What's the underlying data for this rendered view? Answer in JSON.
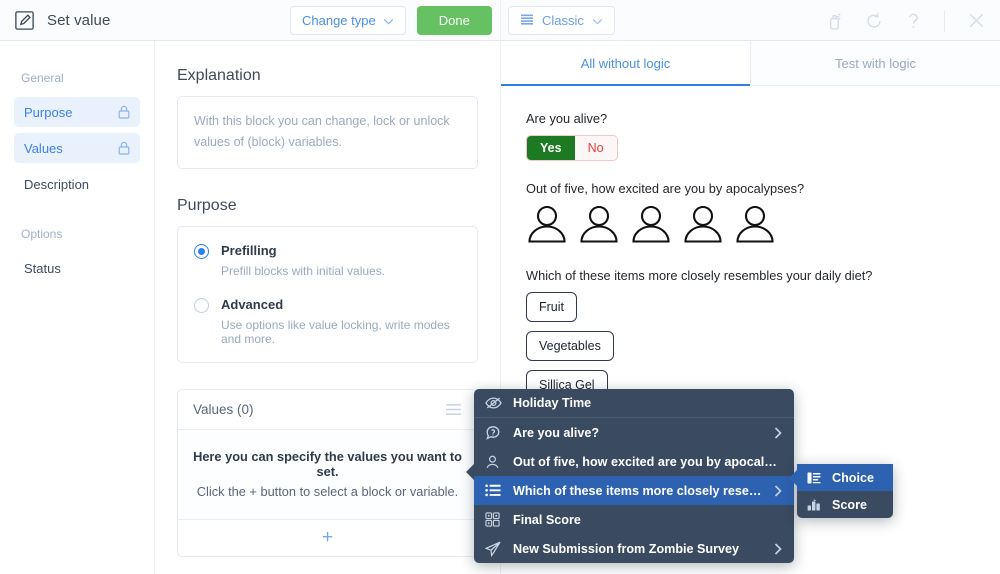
{
  "header": {
    "icon": "pencil-square-icon",
    "title": "Set value",
    "change_type_label": "Change type",
    "done_label": "Done",
    "classic_label": "Classic",
    "icons": [
      "spray-bottle-icon",
      "refresh-icon",
      "help-icon",
      "close-icon"
    ]
  },
  "sidebar": {
    "groups": [
      {
        "label": "General",
        "items": [
          {
            "label": "Purpose",
            "active": true,
            "locked": true
          },
          {
            "label": "Values",
            "active": true,
            "locked": true
          },
          {
            "label": "Description",
            "active": false,
            "locked": false
          }
        ]
      },
      {
        "label": "Options",
        "items": [
          {
            "label": "Status",
            "active": false,
            "locked": false
          }
        ]
      }
    ]
  },
  "middle": {
    "explanation_title": "Explanation",
    "explanation_text": "With this block you can change, lock or unlock values of (block) variables.",
    "purpose_title": "Purpose",
    "purpose_options": [
      {
        "label": "Prefilling",
        "desc": "Prefill blocks with initial values.",
        "selected": true
      },
      {
        "label": "Advanced",
        "desc": "Use options like value locking, write modes and more.",
        "selected": false
      }
    ],
    "values_header": "Values (0)",
    "values_empty_title": "Here you can specify the values you want to set.",
    "values_empty_hint": "Click the + button to select a block or variable.",
    "values_add_label": "+"
  },
  "right": {
    "tabs": [
      {
        "label": "All without logic",
        "active": true
      },
      {
        "label": "Test with logic",
        "active": false
      }
    ],
    "questions": [
      {
        "type": "yesno",
        "label": "Are you alive?",
        "yes_label": "Yes",
        "no_label": "No"
      },
      {
        "type": "rating",
        "label": "Out of five, how excited are you by apocalypses?",
        "count": 5,
        "icon": "person-icon"
      },
      {
        "type": "choice",
        "label": "Which of these items more closely resembles your daily diet?",
        "options": [
          "Fruit",
          "Vegetables",
          "Sillica Gel"
        ]
      }
    ]
  },
  "context_menu": {
    "items": [
      {
        "label": "Holiday Time",
        "icon": "eye-slash-icon",
        "chevron": false,
        "highlighted": false,
        "separator": true
      },
      {
        "label": "Are you alive?",
        "icon": "question-bubble-icon",
        "chevron": true,
        "highlighted": false,
        "separator": false
      },
      {
        "label": "Out of five, how excited are you by apocalypses?",
        "icon": "person-icon",
        "chevron": false,
        "highlighted": false,
        "separator": false
      },
      {
        "label": "Which of these items more closely resembles y…",
        "icon": "list-icon",
        "chevron": true,
        "highlighted": true,
        "separator": false
      },
      {
        "label": "Final Score",
        "icon": "blocks-icon",
        "chevron": false,
        "highlighted": false,
        "separator": false
      },
      {
        "label": "New Submission from Zombie Survey",
        "icon": "paper-plane-icon",
        "chevron": true,
        "highlighted": false,
        "separator": false
      }
    ]
  },
  "submenu": {
    "items": [
      {
        "label": "Choice",
        "icon": "choice-list-icon",
        "highlighted": true
      },
      {
        "label": "Score",
        "icon": "bar-chart-icon",
        "highlighted": false
      }
    ]
  },
  "colors": {
    "accent_blue": "#2f7fe8",
    "done_green": "#66c162",
    "yes_green": "#1d7a22",
    "no_red": "#e04040",
    "menu_bg": "#3a4a61",
    "menu_highlight": "#2d62b0"
  }
}
